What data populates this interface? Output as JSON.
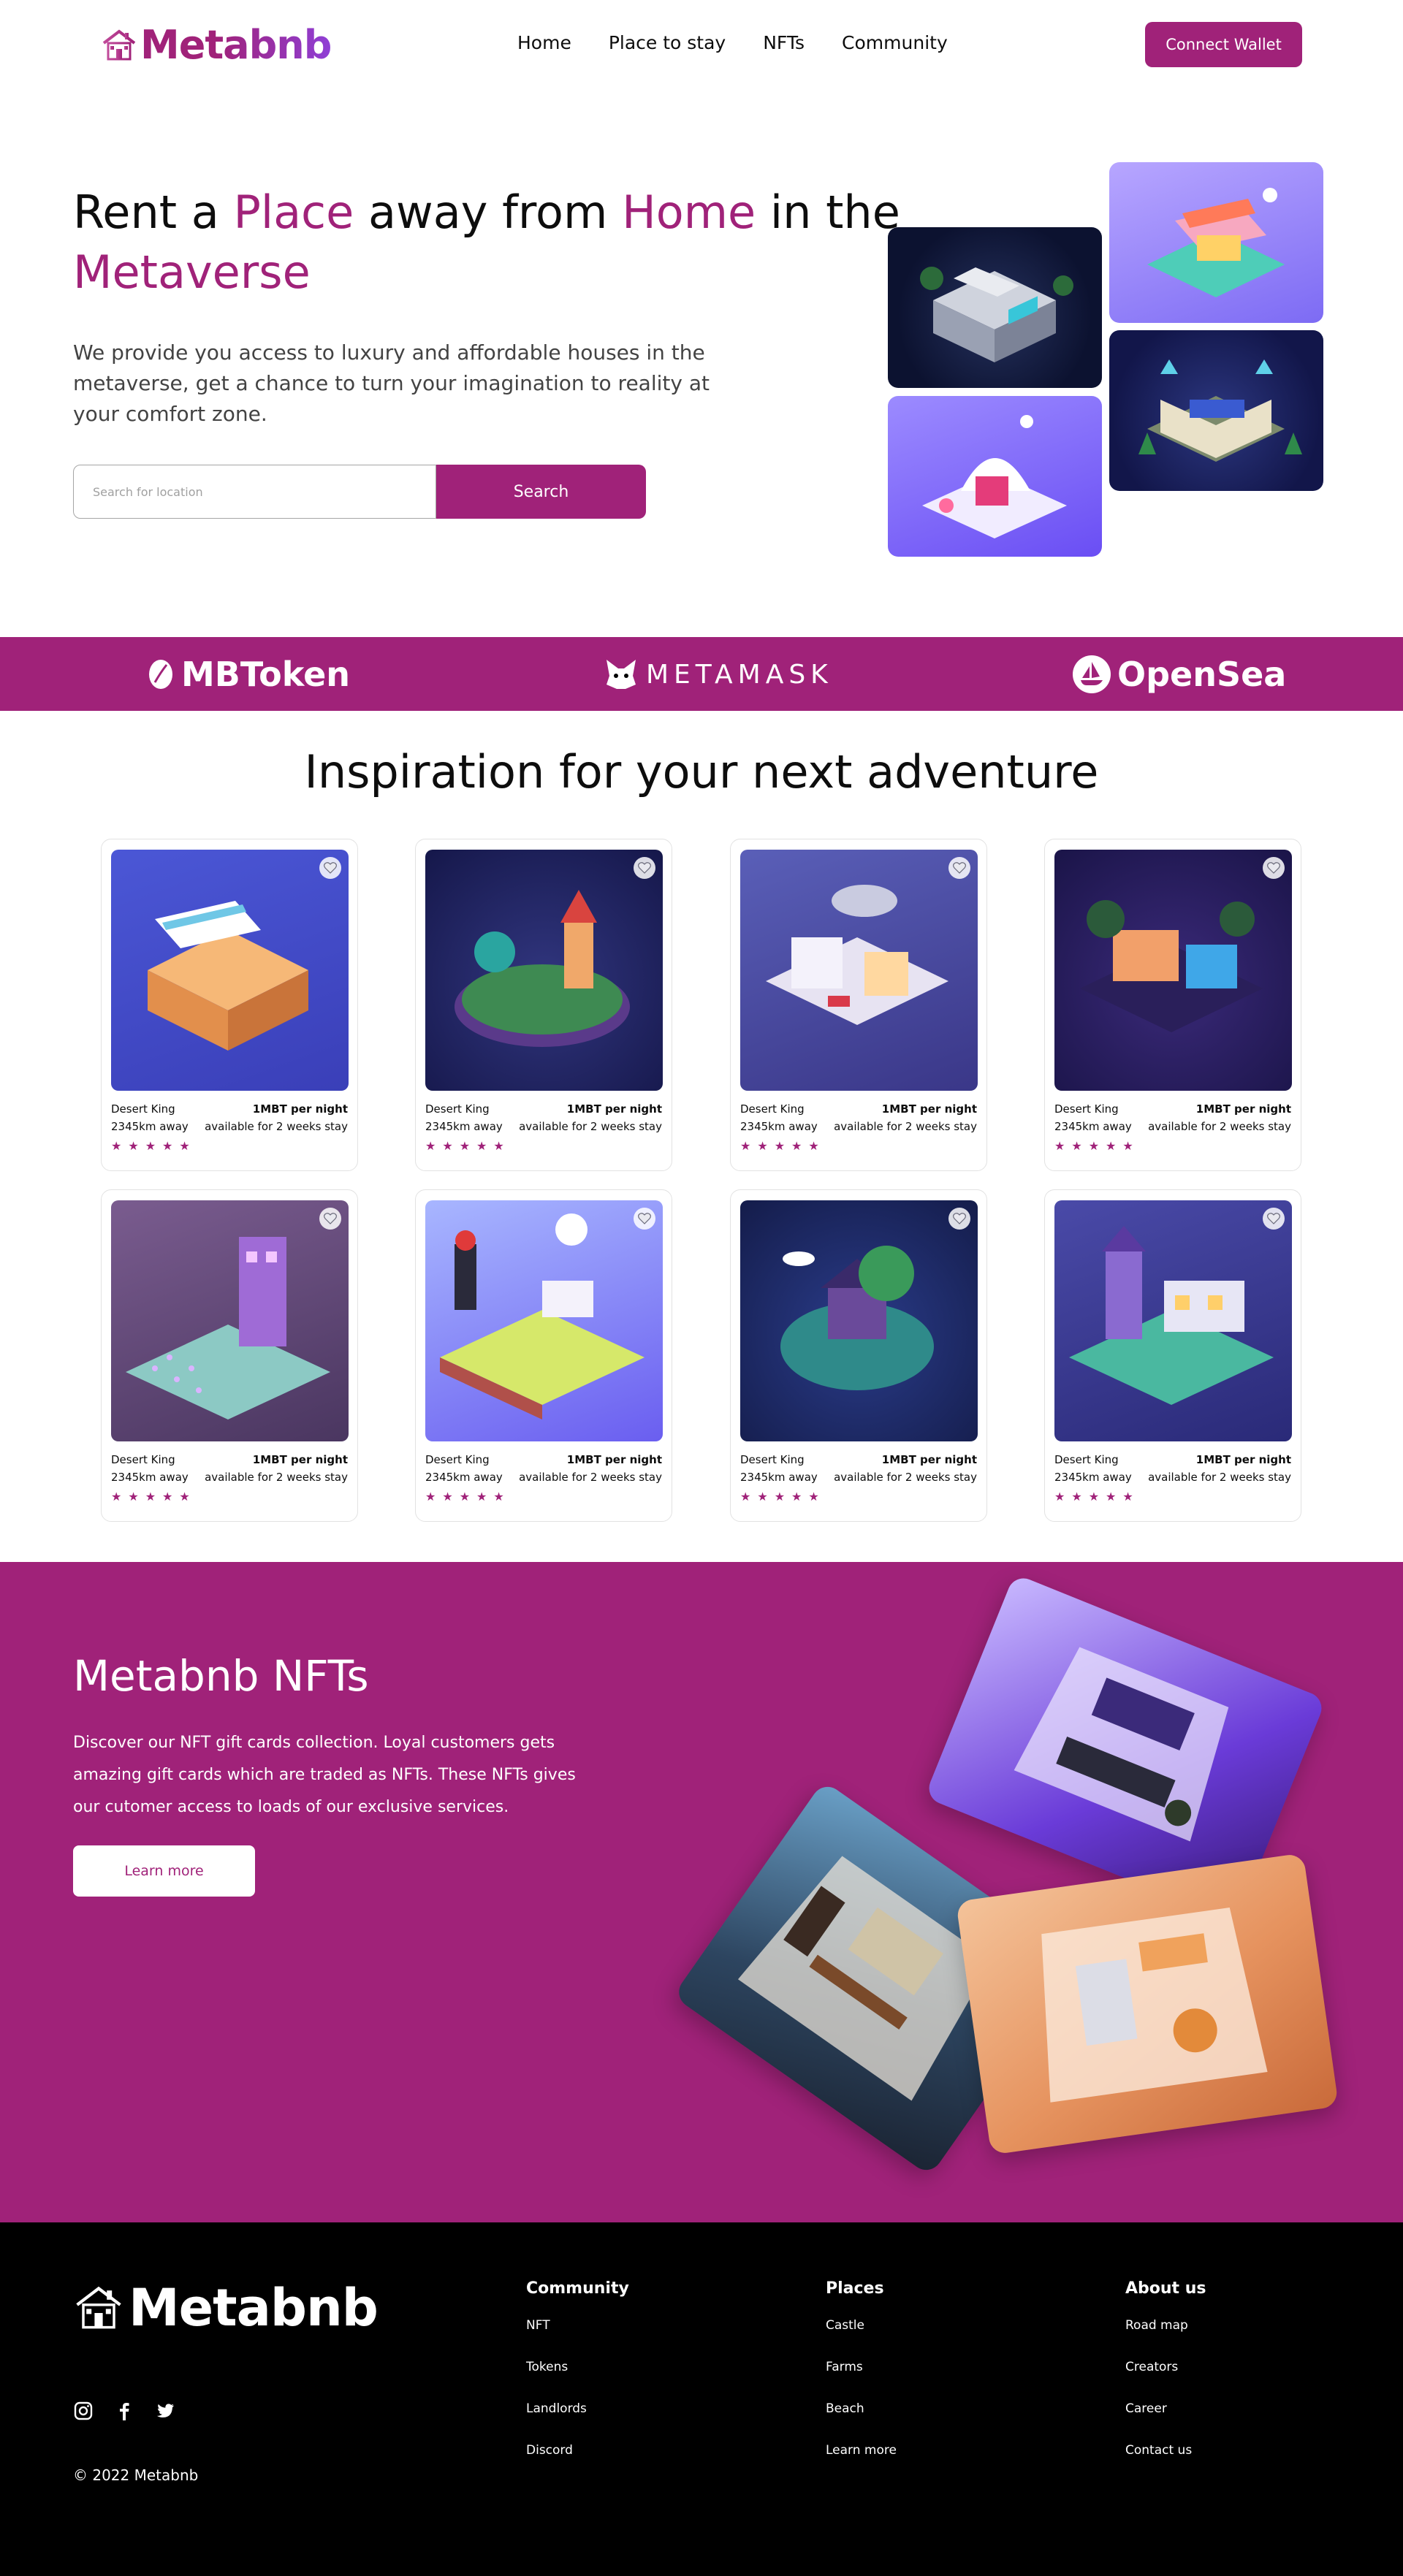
{
  "nav": {
    "brand": "Metabnb",
    "links": [
      "Home",
      "Place to stay",
      "NFTs",
      "Community"
    ],
    "connect_label": "Connect Wallet"
  },
  "hero": {
    "title_parts": [
      "Rent a ",
      "Place",
      " away from ",
      "Home",
      " in the ",
      "Metaverse"
    ],
    "description": "We provide you access to luxury and affordable houses in the metaverse, get a chance to turn your imagination to reality at your comfort zone.",
    "search_placeholder": "Search for location",
    "search_label": "Search"
  },
  "partners": [
    "MBToken",
    "METAMASK",
    "OpenSea"
  ],
  "inspiration": {
    "title": "Inspiration for your next adventure",
    "cards": [
      {
        "name": "Desert King",
        "price": "1MBT per night",
        "distance": "2345km away",
        "availability": "available for 2 weeks stay",
        "rating": 5
      },
      {
        "name": "Desert King",
        "price": "1MBT per night",
        "distance": "2345km away",
        "availability": "available for 2 weeks stay",
        "rating": 5
      },
      {
        "name": "Desert King",
        "price": "1MBT per night",
        "distance": "2345km away",
        "availability": "available for 2 weeks stay",
        "rating": 5
      },
      {
        "name": "Desert King",
        "price": "1MBT per night",
        "distance": "2345km away",
        "availability": "available for 2 weeks stay",
        "rating": 5
      },
      {
        "name": "Desert King",
        "price": "1MBT per night",
        "distance": "2345km away",
        "availability": "available for 2 weeks stay",
        "rating": 5
      },
      {
        "name": "Desert King",
        "price": "1MBT per night",
        "distance": "2345km away",
        "availability": "available for 2 weeks stay",
        "rating": 5
      },
      {
        "name": "Desert King",
        "price": "1MBT per night",
        "distance": "2345km away",
        "availability": "available for 2 weeks stay",
        "rating": 5
      },
      {
        "name": "Desert King",
        "price": "1MBT per night",
        "distance": "2345km away",
        "availability": "available for 2 weeks stay",
        "rating": 5
      }
    ]
  },
  "nft": {
    "title": "Metabnb NFTs",
    "description": "Discover our NFT gift cards collection. Loyal customers gets amazing gift cards which are traded as NFTs. These NFTs gives our cutomer access to loads of our exclusive services.",
    "learn_label": "Learn more"
  },
  "footer": {
    "brand": "Metabnb",
    "socials": [
      "instagram-icon",
      "facebook-icon",
      "twitter-icon"
    ],
    "copyright": "© 2022 Metabnb",
    "columns": [
      {
        "title": "Community",
        "links": [
          "NFT",
          "Tokens",
          "Landlords",
          "Discord"
        ]
      },
      {
        "title": "Places",
        "links": [
          "Castle",
          "Farms",
          "Beach",
          "Learn more"
        ]
      },
      {
        "title": "About us",
        "links": [
          "Road map",
          "Creators",
          "Career",
          "Contact us"
        ]
      }
    ]
  },
  "colors": {
    "accent": "#a02279",
    "purple": "#8f3fd6",
    "footer_bg": "#000000"
  }
}
